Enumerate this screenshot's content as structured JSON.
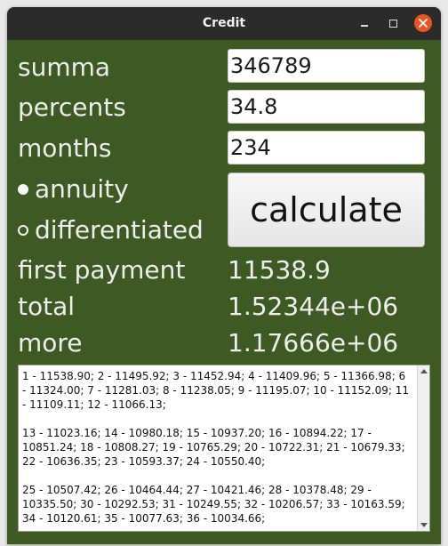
{
  "window": {
    "title": "Credit"
  },
  "form": {
    "summa_label": "summa",
    "summa_value": "346789",
    "percents_label": "percents",
    "percents_value": "34.8",
    "months_label": "months",
    "months_value": "234",
    "annuity_label": "annuity",
    "differentiated_label": "differentiated",
    "selected": "annuity",
    "calculate_label": "calculate"
  },
  "results": {
    "first_payment_label": "first payment",
    "first_payment_value": "11538.9",
    "total_label": "total",
    "total_value": "1.52344e+06",
    "more_label": "more",
    "more_value": "1.17666e+06"
  },
  "schedule_text": "1 - 11538.90; 2 - 11495.92; 3 - 11452.94; 4 - 11409.96; 5 - 11366.98; 6 - 11324.00; 7 - 11281.03; 8 - 11238.05; 9 - 11195.07; 10 - 11152.09; 11 - 11109.11; 12 - 11066.13;\n\n13 - 11023.16; 14 - 10980.18; 15 - 10937.20; 16 - 10894.22; 17 - 10851.24; 18 - 10808.27; 19 - 10765.29; 20 - 10722.31; 21 - 10679.33; 22 - 10636.35; 23 - 10593.37; 24 - 10550.40;\n\n25 - 10507.42; 26 - 10464.44; 27 - 10421.46; 28 - 10378.48; 29 - 10335.50; 30 - 10292.53; 31 - 10249.55; 32 - 10206.57; 33 - 10163.59; 34 - 10120.61; 35 - 10077.63; 36 - 10034.66;",
  "colors": {
    "window_bg": "#3c5a22",
    "titlebar_bg": "#2b2b2b",
    "close_button": "#e95420"
  },
  "icons": {
    "minimize": "minimize-icon",
    "maximize": "maximize-icon",
    "close": "close-icon"
  }
}
